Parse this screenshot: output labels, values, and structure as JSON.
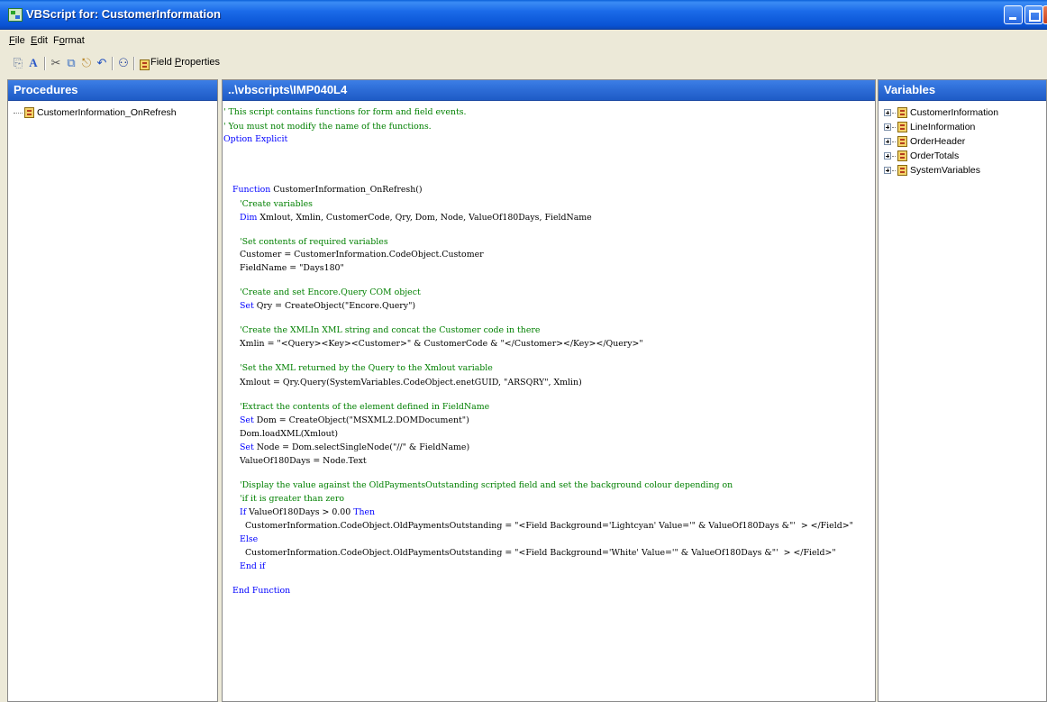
{
  "window": {
    "title": "VBScript for: CustomerInformation"
  },
  "menu": [
    "File",
    "Edit",
    "Format"
  ],
  "toolbar": {
    "field_properties_label": "Field Properties"
  },
  "procedures": {
    "header": "Procedures",
    "items": [
      "CustomerInformation_OnRefresh"
    ]
  },
  "editor": {
    "header": "..\\vbscripts\\IMP040L4",
    "lines": [
      {
        "indent": 0,
        "text": "' This script contains functions for form and field events.",
        "kind": "comment"
      },
      {
        "indent": 0,
        "text": "' You must not modify the name of the functions.",
        "kind": "comment"
      },
      {
        "indent": 0,
        "text": "Option Explicit",
        "kind": "keyword"
      },
      {
        "indent": 1,
        "text": "Function CustomerInformation_OnRefresh()",
        "kind": "function"
      },
      {
        "indent": 2,
        "text": "'Create variables",
        "kind": "comment"
      },
      {
        "indent": 2,
        "text": "Dim Xmlout, Xmlin, CustomerCode, Qry, Dom, Node, ValueOf180Days, FieldName",
        "kind": "dim"
      },
      {
        "indent": 2,
        "text": "'Set contents of required variables",
        "kind": "comment"
      },
      {
        "indent": 2,
        "text": "Customer = CustomerInformation.CodeObject.Customer",
        "kind": "plain"
      },
      {
        "indent": 2,
        "text": "FieldName = \"Days180\"",
        "kind": "plain"
      },
      {
        "indent": 2,
        "text": "'Create and set Encore.Query COM object",
        "kind": "comment"
      },
      {
        "indent": 2,
        "text": "Set Qry = CreateObject(\"Encore.Query\")",
        "kind": "set"
      },
      {
        "indent": 2,
        "text": "'Create the XMLIn XML string and concat the Customer code in there",
        "kind": "comment"
      },
      {
        "indent": 2,
        "text": "Xmlin = \"<Query><Key><Customer>\" & CustomerCode & \"</Customer></Key></Query>\"",
        "kind": "plain"
      },
      {
        "indent": 2,
        "text": "'Set the XML returned by the Query to the Xmlout variable",
        "kind": "comment"
      },
      {
        "indent": 2,
        "text": "Xmlout = Qry.Query(SystemVariables.CodeObject.enetGUID, \"ARSQRY\", Xmlin)",
        "kind": "plain"
      },
      {
        "indent": 2,
        "text": "'Extract the contents of the element defined in FieldName",
        "kind": "comment"
      },
      {
        "indent": 2,
        "text": "Set Dom = CreateObject(\"MSXML2.DOMDocument\")",
        "kind": "set"
      },
      {
        "indent": 2,
        "text": "Dom.loadXML(Xmlout)",
        "kind": "plain"
      },
      {
        "indent": 2,
        "text": "Set Node = Dom.selectSingleNode(\"//\" & FieldName)",
        "kind": "set"
      },
      {
        "indent": 2,
        "text": "ValueOf180Days = Node.Text",
        "kind": "plain"
      },
      {
        "indent": 2,
        "text": "'Display the value against the OldPaymentsOutstanding scripted field and set the background colour depending on",
        "kind": "comment"
      },
      {
        "indent": 2,
        "text": "'if it is greater than zero",
        "kind": "comment"
      },
      {
        "indent": 2,
        "text": "If ValueOf180Days > 0.00 Then",
        "kind": "if"
      },
      {
        "indent": 3,
        "text": "CustomerInformation.CodeObject.OldPaymentsOutstanding = \"<Field Background='Lightcyan' Value='\" & ValueOf180Days &\"'  > </Field>\"",
        "kind": "plain"
      },
      {
        "indent": 2,
        "text": "Else",
        "kind": "keyword"
      },
      {
        "indent": 3,
        "text": "CustomerInformation.CodeObject.OldPaymentsOutstanding = \"<Field Background='White' Value='\" & ValueOf180Days &\"'  > </Field>\"",
        "kind": "plain"
      },
      {
        "indent": 2,
        "text": "End if",
        "kind": "keyword"
      },
      {
        "indent": 1,
        "text": "End Function",
        "kind": "keyword"
      }
    ]
  },
  "variables": {
    "header": "Variables",
    "items": [
      "CustomerInformation",
      "LineInformation",
      "OrderHeader",
      "OrderTotals",
      "SystemVariables"
    ]
  },
  "colors": {
    "title_bar": "#0a5fd8",
    "pane_header": "#2f6fd9",
    "comment": "#008000",
    "keyword": "#0000ff"
  }
}
